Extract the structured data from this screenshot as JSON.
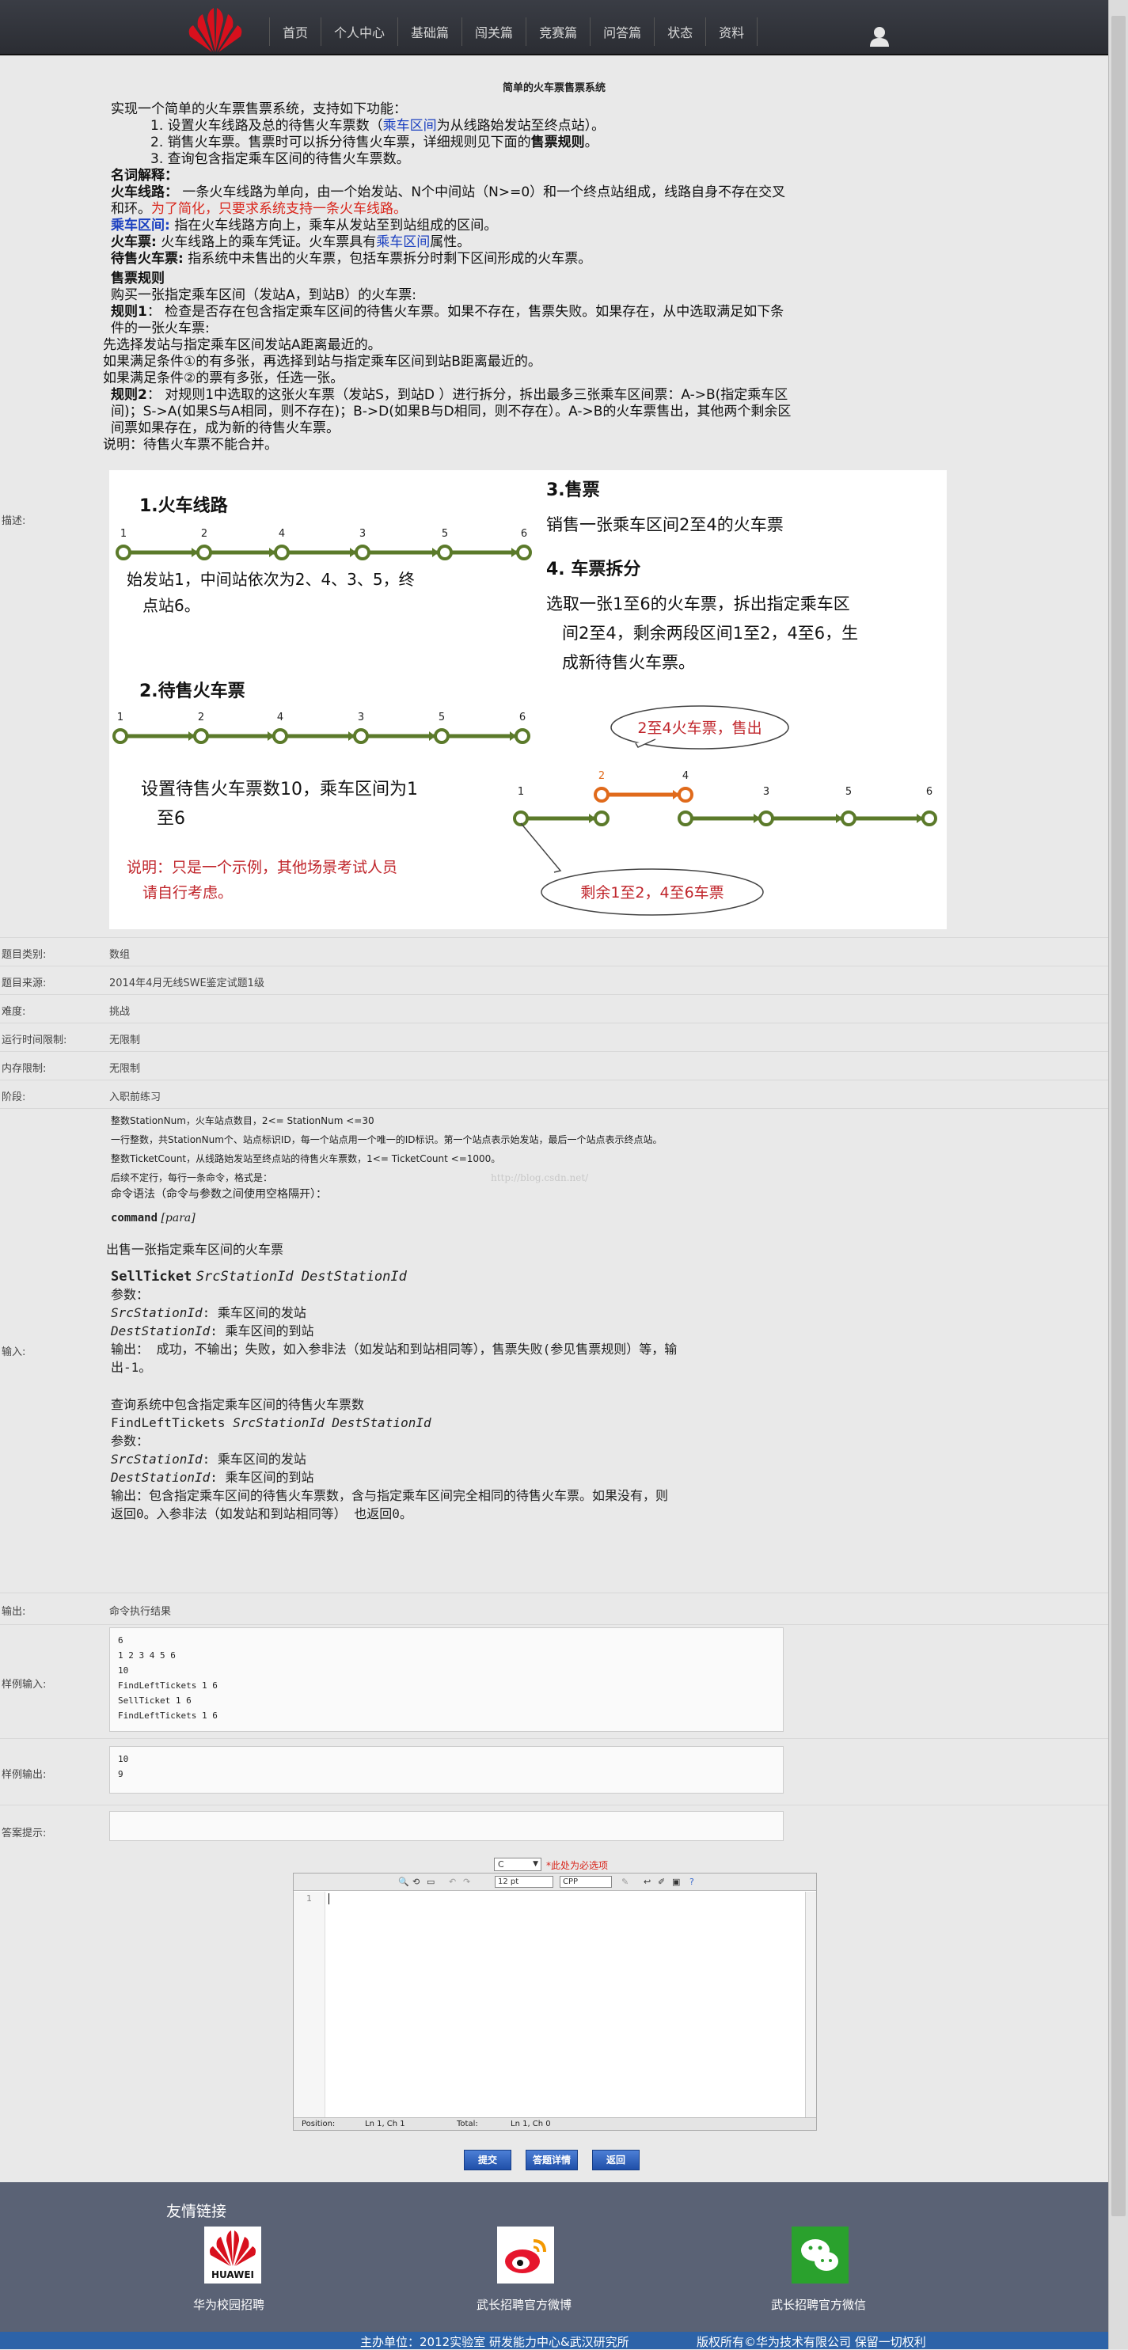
{
  "nav": {
    "items": [
      "首页",
      "个人中心",
      "基础篇",
      "闯关篇",
      "竞赛篇",
      "问答篇",
      "状态",
      "资料"
    ]
  },
  "problem": {
    "title": "简单的火车票售票系统",
    "description": {
      "intro": "实现一个简单的火车票售票系统，支持如下功能：",
      "f1a": "1. 设置火车线路及总的待售火车票数（",
      "f1b": "乘车区间",
      "f1c": "为从线路始发站至终点站）。",
      "f2a": "2. 销售火车票。售票时可以拆分待售火车票，详细规则见下面的",
      "f2b": "售票规则",
      "f2c": "。",
      "f3": "3. 查询包含指定乘车区间的待售火车票数。",
      "terms_title": "名词解释：",
      "t1_label": "火车线路：",
      "t1_text": "    一条火车线路为单向，由一个始发站、N个中间站（N>=0）和一个终点站组成，线路自身不存在交叉和环。",
      "t1_red": "为了简化，只要求系统支持一条火车线路。",
      "t2_label": "乘车区间:",
      "t2_text": "  指在火车线路方向上，乘车从发站至到站组成的区间。",
      "t3_label": "火车票:",
      "t3_texta": "  火车线路上的乘车凭证。火车票具有",
      "t3_textb": "乘车区间",
      "t3_textc": "属性。",
      "t4_label": "待售火车票:",
      "t4_text": "     指系统中未售出的火车票，包括车票拆分时剩下区间形成的火车票。",
      "rules_title": "售票规则",
      "r0": "购买一张指定乘车区间（发站A，到站B）的火车票:",
      "r1_label": "规则1",
      "r1_text": "：  检查是否存在包含指定乘车区间的待售火车票。如果不存在，售票失败。如果存在，从中选取满足如下条件的一张火车票:",
      "r1a": "先选择发站与指定乘车区间发站A距离最近的。",
      "r1b": "如果满足条件①的有多张，再选择到站与指定乘车区间到站B距离最近的。",
      "r1c": "如果满足条件②的票有多张，任选一张。",
      "r2_label": "规则2",
      "r2_text": "：  对规则1中选取的这张火车票（发站S，到站D ）进行拆分，拆出最多三张乘车区间票：A->B(指定乘车区间)；S->A(如果S与A相同，则不存在)；B->D(如果B与D相同，则不存在）。A->B的火车票售出，其他两个剩余区间票如果存在，成为新的待售火车票。",
      "note": "说明：待售火车票不能合并。"
    },
    "diagram": {
      "s1_title": "1.火车线路",
      "s1_stations": [
        "1",
        "2",
        "4",
        "3",
        "5",
        "6"
      ],
      "s1_caption_a": "始发站1，中间站依次为2、4、3、5，终",
      "s1_caption_b": "点站6。",
      "s2_title": "2.待售火车票",
      "s2_stations": [
        "1",
        "2",
        "4",
        "3",
        "5",
        "6"
      ],
      "s2_caption_a": "设置待售火车票数10，乘车区间为1",
      "s2_caption_b": "至6",
      "s2_note_a": "说明：只是一个示例，其他场景考试人员",
      "s2_note_b": "请自行考虑。",
      "s3_title": "3.售票",
      "s3_text": "销售一张乘车区间2至4的火车票",
      "s4_title": "4. 车票拆分",
      "s4_text_a": "选取一张1至6的火车票，拆出指定乘车区",
      "s4_text_b": "间2至4，剩余两段区间1至2，4至6，生",
      "s4_text_c": "成新待售火车票。",
      "bubble_sold": "2至4火车票，售出",
      "bubble_left": "剩余1至2，4至6车票",
      "s4_stations": [
        "1",
        "2",
        "4",
        "3",
        "5",
        "6"
      ]
    },
    "fields": {
      "desc_label": "描述:",
      "category_label": "题目类别:",
      "category": "数组",
      "source_label": "题目来源:",
      "source": "2014年4月无线SWE鉴定试题1级",
      "difficulty_label": "难度:",
      "difficulty": "挑战",
      "time_label": "运行时间限制:",
      "time": "无限制",
      "memory_label": "内存限制:",
      "memory": "无限制",
      "stage_label": "阶段:",
      "stage": "入职前练习",
      "input_label": "输入:",
      "output_label": "输出:",
      "output": "命令执行结果",
      "sample_in_label": "样例输入:",
      "sample_out_label": "样例输出:",
      "hint_label": "答案提示:"
    },
    "input": {
      "l1": "整数StationNum，火车站点数目，2<= StationNum <=30",
      "l2": "一行整数，共StationNum个、站点标识ID，每一个站点用一个唯一的ID标识。第一个站点表示始发站，最后一个站点表示终点站。",
      "l3": "整数TicketCount，从线路始发站至终点站的待售火车票数，1<= TicketCount <=1000。",
      "l4": "后续不定行，每行一条命令，格式是：",
      "watermark": "http://blog.csdn.net/",
      "l5": "命令语法（命令与参数之间使用空格隔开）：",
      "cmd": "command",
      "para": "[para]",
      "sell_title": "出售一张指定乘车区间的火车票",
      "sell_cmd": "SellTicket",
      "sell_args": "SrcStationId DestStationId",
      "params": "参数：",
      "src_name": "SrcStationId",
      "src_desc": ":    乘车区间的发站",
      "dest_name": "DestStationId",
      "dest_desc": ":    乘车区间的到站",
      "sell_out_a": "输出：  成功，不输出；失败，如入参非法（如发站和到站相同等），售票失败(参见售票规则）等，输",
      "sell_out_b": "出-1。",
      "query_title": "查询系统中包含指定乘车区间的待售火车票数",
      "query_cmd": "FindLeftTickets",
      "query_args": "SrcStationId DestStationId",
      "q_out_a": "输出：包含指定乘车区间的待售火车票数，含与指定乘车区间完全相同的待售火车票。如果没有，则",
      "q_out_b": "返回0。入参非法（如发站和到站相同等） 也返回0。"
    },
    "sample_input": [
      "6",
      "1 2 3 4 5 6",
      "10",
      "FindLeftTickets 1 6",
      "SellTicket 1 6",
      "FindLeftTickets 1 6"
    ],
    "sample_output": [
      "10",
      "9"
    ],
    "hint": ""
  },
  "editor": {
    "language": "C",
    "required_note": "*此处为必选项",
    "font_size": "12 pt",
    "syntax": "CPP",
    "line_number": "1",
    "status_position_label": "Position:",
    "status_position": "Ln 1, Ch 1",
    "status_total_label": "Total:",
    "status_total": "Ln 1, Ch 0"
  },
  "buttons": {
    "submit": "提交",
    "details": "答题详情",
    "back": "返回"
  },
  "footer": {
    "title": "友情链接",
    "links": [
      "华为校园招聘",
      "武长招聘官方微博",
      "武长招聘官方微信"
    ],
    "huawei_logo_text": "HUAWEI",
    "organizer": "主办单位：2012实验室 研发能力中心&武汉研究所",
    "copyright": "版权所有©华为技术有限公司 保留一切权利"
  },
  "colors": {
    "topbar": "#2f3138",
    "footer": "#5a6275",
    "footer_bar": "#2d63a8",
    "track_green": "#5b7a2a",
    "track_orange": "#e06a1b",
    "link_blue": "#1a3fc0",
    "warn_red": "#d9261c"
  }
}
